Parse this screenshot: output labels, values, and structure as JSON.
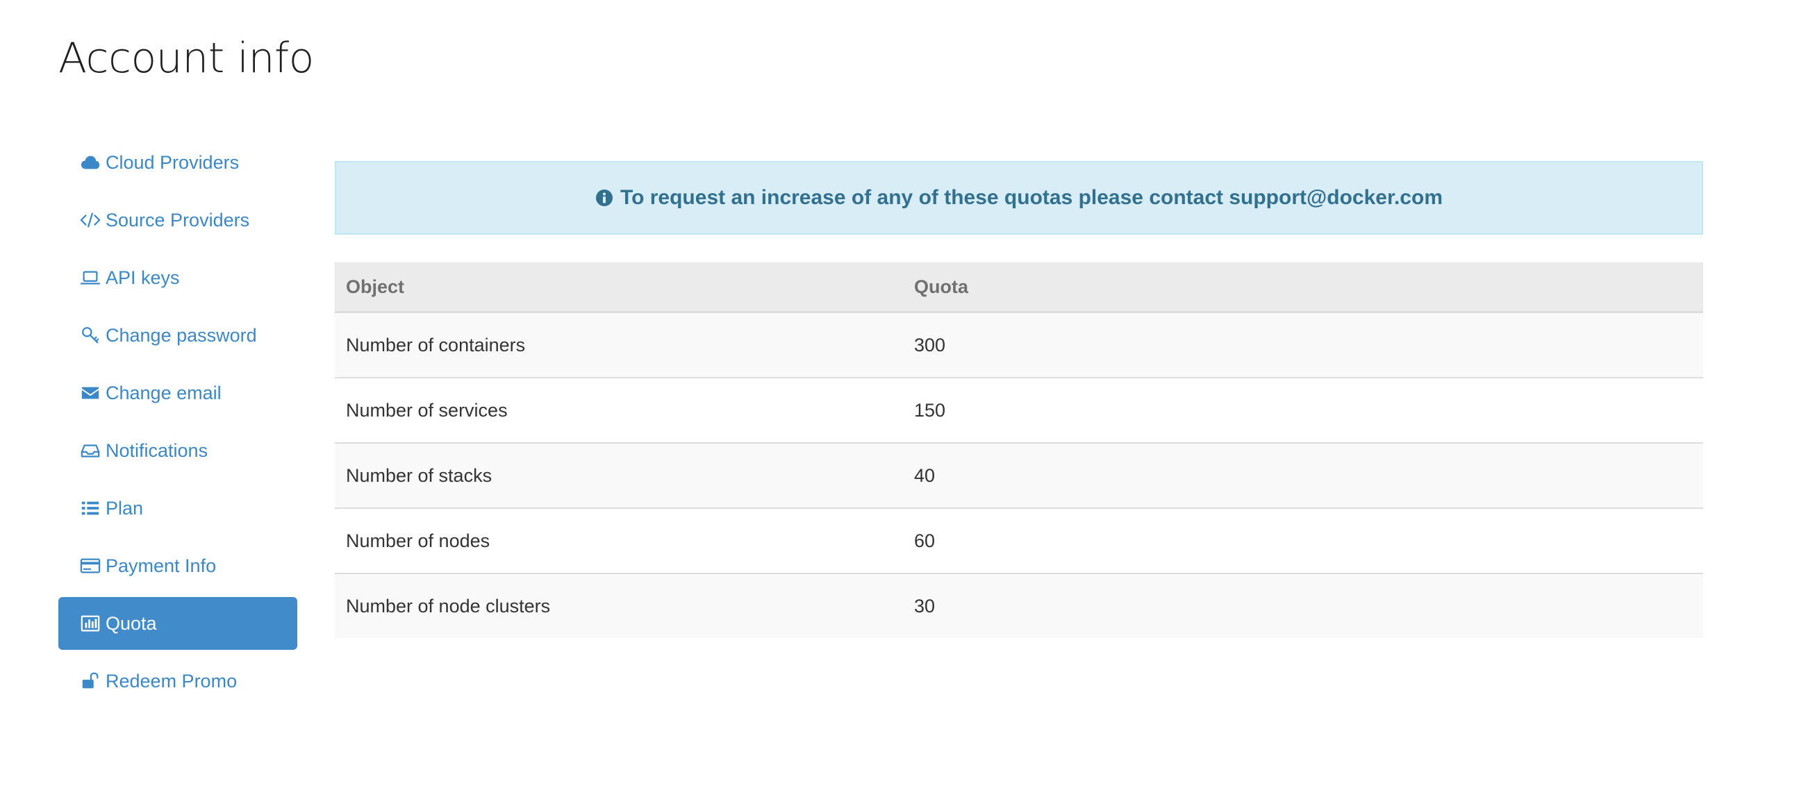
{
  "page": {
    "title": "Account info"
  },
  "sidebar": {
    "items": [
      {
        "label": "Cloud Providers",
        "icon": "cloud-icon"
      },
      {
        "label": "Source Providers",
        "icon": "code-icon"
      },
      {
        "label": "API keys",
        "icon": "laptop-icon"
      },
      {
        "label": "Change password",
        "icon": "key-icon"
      },
      {
        "label": "Change email",
        "icon": "envelope-icon"
      },
      {
        "label": "Notifications",
        "icon": "inbox-icon"
      },
      {
        "label": "Plan",
        "icon": "list-icon"
      },
      {
        "label": "Payment Info",
        "icon": "credit-card-icon"
      },
      {
        "label": "Quota",
        "icon": "bar-chart-icon",
        "active": true
      },
      {
        "label": "Redeem Promo",
        "icon": "unlock-icon"
      }
    ]
  },
  "alert": {
    "icon": "info-circle-icon",
    "text": "To request an increase of any of these quotas please contact support@docker.com"
  },
  "table": {
    "headers": [
      "Object",
      "Quota"
    ],
    "rows": [
      {
        "object": "Number of containers",
        "quota": "300"
      },
      {
        "object": "Number of services",
        "quota": "150"
      },
      {
        "object": "Number of stacks",
        "quota": "40"
      },
      {
        "object": "Number of nodes",
        "quota": "60"
      },
      {
        "object": "Number of node clusters",
        "quota": "30"
      }
    ]
  },
  "colors": {
    "link": "#3a88c8",
    "active_bg": "#428bca",
    "alert_bg": "#d9edf7",
    "alert_text": "#31708f"
  }
}
